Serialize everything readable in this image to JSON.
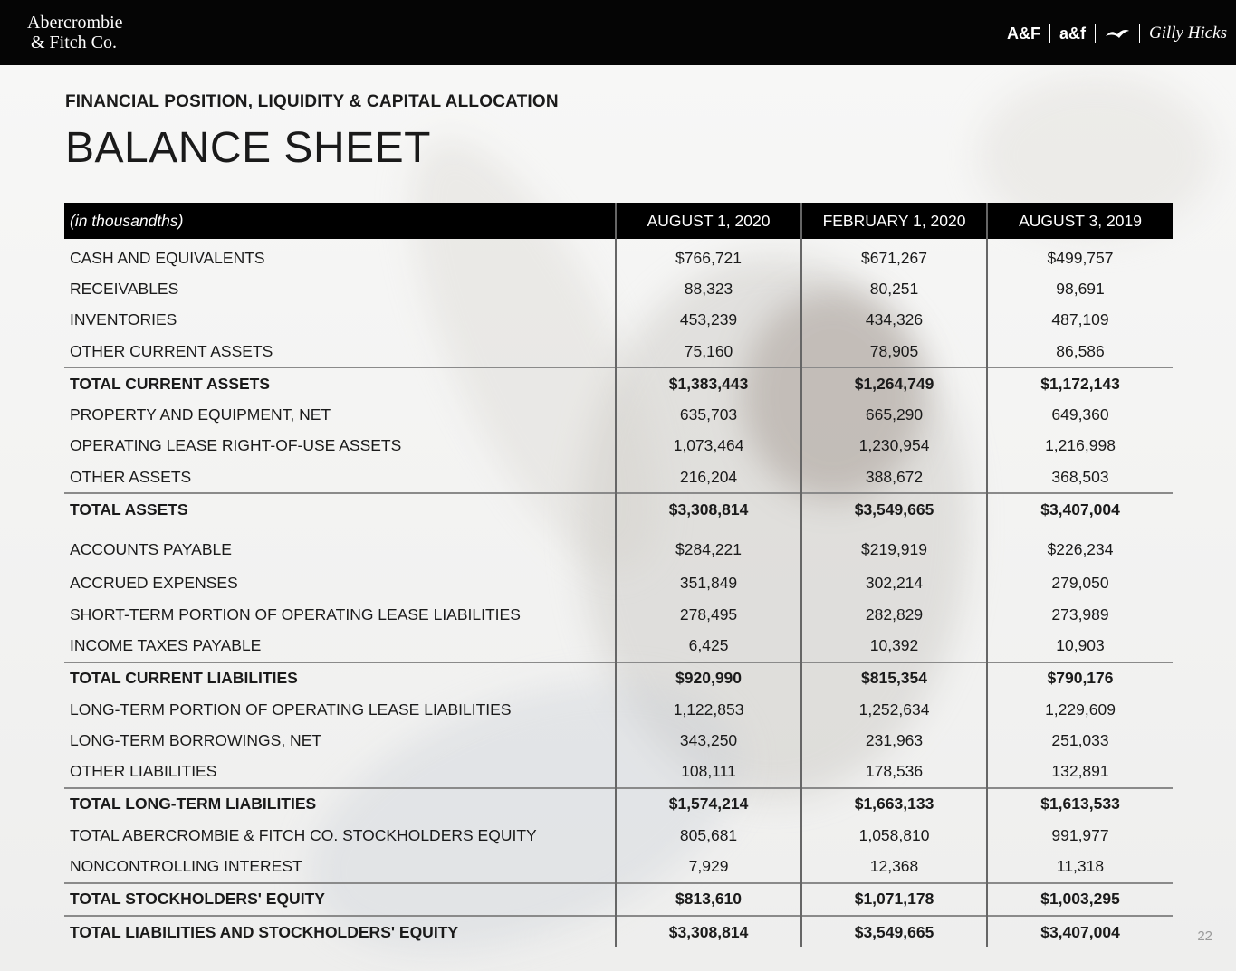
{
  "header": {
    "logo_line1": "Abercrombie",
    "logo_line2": "& Fitch Co.",
    "brand_af": "A&F",
    "brand_af_kids": "a&f",
    "brand_hollister_icon": "seagull-icon",
    "brand_gilly": "Gilly Hicks"
  },
  "kicker": "FINANCIAL POSITION, LIQUIDITY & CAPITAL ALLOCATION",
  "title": "BALANCE SHEET",
  "table": {
    "header": [
      "(in thousandths)",
      "AUGUST 1, 2020",
      "FEBRUARY 1, 2020",
      "AUGUST 3, 2019"
    ],
    "rows": [
      {
        "label": "CASH AND EQUIVALENTS",
        "values": [
          "$766,721",
          "$671,267",
          "$499,757"
        ],
        "total": false
      },
      {
        "label": "RECEIVABLES",
        "values": [
          "88,323",
          "80,251",
          "98,691"
        ],
        "total": false
      },
      {
        "label": "INVENTORIES",
        "values": [
          "453,239",
          "434,326",
          "487,109"
        ],
        "total": false
      },
      {
        "label": "OTHER CURRENT ASSETS",
        "values": [
          "75,160",
          "78,905",
          "86,586"
        ],
        "total": false
      },
      {
        "label": "TOTAL CURRENT ASSETS",
        "values": [
          "$1,383,443",
          "$1,264,749",
          "$1,172,143"
        ],
        "total": true
      },
      {
        "label": "PROPERTY AND EQUIPMENT, NET",
        "values": [
          "635,703",
          "665,290",
          "649,360"
        ],
        "total": false
      },
      {
        "label": "OPERATING LEASE RIGHT-OF-USE ASSETS",
        "values": [
          "1,073,464",
          "1,230,954",
          "1,216,998"
        ],
        "total": false
      },
      {
        "label": "OTHER ASSETS",
        "values": [
          "216,204",
          "388,672",
          "368,503"
        ],
        "total": false
      },
      {
        "label": "TOTAL ASSETS",
        "values": [
          "$3,308,814",
          "$3,549,665",
          "$3,407,004"
        ],
        "total": true
      },
      {
        "label": "ACCOUNTS PAYABLE",
        "values": [
          "$284,221",
          "$219,919",
          "$226,234"
        ],
        "total": false
      },
      {
        "label": "ACCRUED EXPENSES",
        "values": [
          "351,849",
          "302,214",
          "279,050"
        ],
        "total": false
      },
      {
        "label": "SHORT-TERM PORTION OF OPERATING LEASE LIABILITIES",
        "values": [
          "278,495",
          "282,829",
          "273,989"
        ],
        "total": false
      },
      {
        "label": "INCOME TAXES PAYABLE",
        "values": [
          "6,425",
          "10,392",
          "10,903"
        ],
        "total": false
      },
      {
        "label": "TOTAL CURRENT LIABILITIES",
        "values": [
          "$920,990",
          "$815,354",
          "$790,176"
        ],
        "total": true
      },
      {
        "label": "LONG-TERM PORTION OF OPERATING LEASE LIABILITIES",
        "values": [
          "1,122,853",
          "1,252,634",
          "1,229,609"
        ],
        "total": false
      },
      {
        "label": "LONG-TERM BORROWINGS, NET",
        "values": [
          "343,250",
          "231,963",
          "251,033"
        ],
        "total": false
      },
      {
        "label": "OTHER LIABILITIES",
        "values": [
          "108,111",
          "178,536",
          "132,891"
        ],
        "total": false
      },
      {
        "label": "TOTAL LONG-TERM LIABILITIES",
        "values": [
          "$1,574,214",
          "$1,663,133",
          "$1,613,533"
        ],
        "total": true
      },
      {
        "label": "TOTAL ABERCROMBIE & FITCH CO. STOCKHOLDERS EQUITY",
        "values": [
          "805,681",
          "1,058,810",
          "991,977"
        ],
        "total": false
      },
      {
        "label": "NONCONTROLLING INTEREST",
        "values": [
          "7,929",
          "12,368",
          "11,318"
        ],
        "total": false
      },
      {
        "label": "TOTAL STOCKHOLDERS' EQUITY",
        "values": [
          "$813,610",
          "$1,071,178",
          "$1,003,295"
        ],
        "total": true
      },
      {
        "label": "TOTAL LIABILITIES AND STOCKHOLDERS' EQUITY",
        "values": [
          "$3,308,814",
          "$3,549,665",
          "$3,407,004"
        ],
        "total": true
      }
    ]
  },
  "page_number": "22"
}
